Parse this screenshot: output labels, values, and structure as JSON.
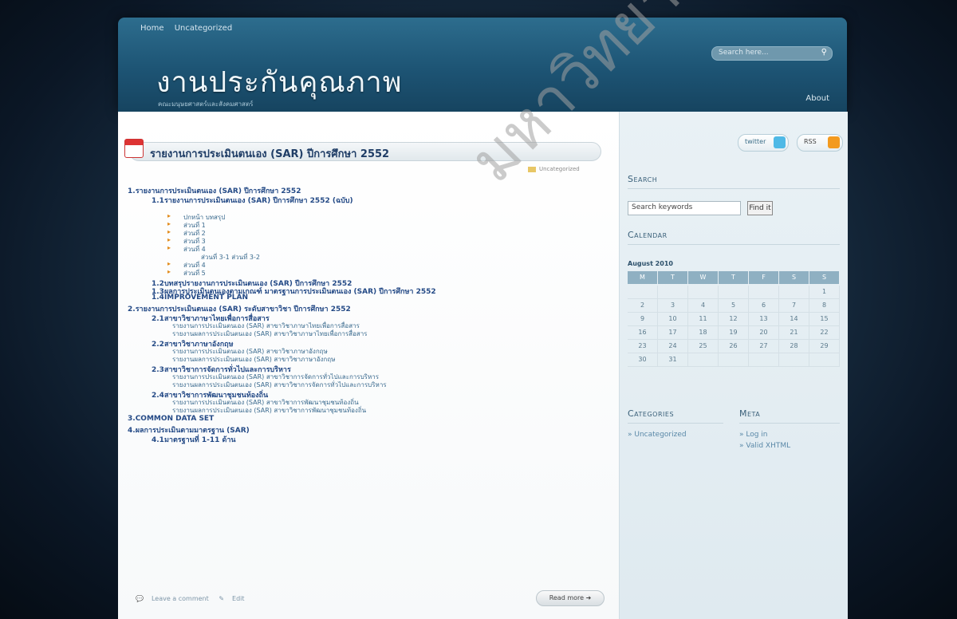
{
  "topnav": {
    "home": "Home",
    "uncategorized": "Uncategorized"
  },
  "site": {
    "title": "งานประกันคุณภาพ",
    "description": "คณะมนุษยศาสตร์และสังคมศาสตร์",
    "about": "About"
  },
  "search_top": {
    "placeholder": "Search here..."
  },
  "post": {
    "title": "รายงานการประเมินตนเอง (SAR) ปีการศึกษา 2552",
    "category": "Uncategorized",
    "toc": [
      {
        "num": "1.",
        "text": "รายงานการประเมินตนเอง (SAR) ปีการศึกษา 2552"
      },
      {
        "num": "1.1",
        "text": "รายงานการประเมินตนเอง (SAR) ปีการศึกษา 2552 (ฉบับ)"
      },
      {
        "num": "",
        "text": "ปกหน้า บทสรุป"
      },
      {
        "num": "",
        "text": "ส่วนที่ 1"
      },
      {
        "num": "",
        "text": "ส่วนที่ 2"
      },
      {
        "num": "",
        "text": "ส่วนที่ 3"
      },
      {
        "num": "",
        "text": "ส่วนที่ 4"
      },
      {
        "num": "",
        "text": "ส่วนที่ 3-1 ส่วนที่ 3-2"
      },
      {
        "num": "",
        "text": "ส่วนที่ 4"
      },
      {
        "num": "",
        "text": "ส่วนที่ 5"
      },
      {
        "num": "1.2",
        "text": "บทสรุปรายงานการประเมินตนเอง (SAR) ปีการศึกษา 2552"
      },
      {
        "num": "1.3",
        "text": "ผลการประเมินตนเองตามเกณฑ์ มาตรฐานการประเมินตนเอง (SAR) ปีการศึกษา 2552"
      },
      {
        "num": "1.4",
        "text": "IMPROVEMENT PLAN"
      },
      {
        "num": "2.",
        "text": "รายงานการประเมินตนเอง (SAR) ระดับสาขาวิชา ปีการศึกษา 2552"
      },
      {
        "num": "2.1",
        "text": "สาขาวิชาภาษาไทยเพื่อการสื่อสาร"
      },
      {
        "num": "",
        "text": "รายงานการประเมินตนเอง (SAR) สาขาวิชาภาษาไทยเพื่อการสื่อสาร"
      },
      {
        "num": "",
        "text": "รายงานผลการประเมินตนเอง (SAR) สาขาวิชาภาษาไทยเพื่อการสื่อสาร"
      },
      {
        "num": "2.2",
        "text": "สาขาวิชาภาษาอังกฤษ"
      },
      {
        "num": "",
        "text": "รายงานการประเมินตนเอง (SAR) สาขาวิชาภาษาอังกฤษ"
      },
      {
        "num": "",
        "text": "รายงานผลการประเมินตนเอง (SAR) สาขาวิชาภาษาอังกฤษ"
      },
      {
        "num": "2.3",
        "text": "สาขาวิชาการจัดการทั่วไปและการบริหาร"
      },
      {
        "num": "",
        "text": "รายงานการประเมินตนเอง (SAR) สาขาวิชาการจัดการทั่วไปและการบริหาร"
      },
      {
        "num": "",
        "text": "รายงานผลการประเมินตนเอง (SAR) สาขาวิชาการจัดการทั่วไปและการบริหาร"
      },
      {
        "num": "2.4",
        "text": "สาขาวิชาการพัฒนาชุมชนท้องถิ่น"
      },
      {
        "num": "",
        "text": "รายงานการประเมินตนเอง (SAR) สาขาวิชาการพัฒนาชุมชนท้องถิ่น"
      },
      {
        "num": "",
        "text": "รายงานผลการประเมินตนเอง (SAR) สาขาวิชาการพัฒนาชุมชนท้องถิ่น"
      },
      {
        "num": "3.",
        "text": "COMMON DATA SET"
      },
      {
        "num": "4.",
        "text": "ผลการประเมินตามมาตรฐาน (SAR)"
      },
      {
        "num": "4.1",
        "text": "มาตรฐานที่ 1-11 ด้าน"
      }
    ],
    "leave_comment": "Leave a comment",
    "edit": "Edit",
    "read_more": "Read more"
  },
  "sidebar": {
    "twitter": "twitter",
    "rss": "RSS",
    "search_heading": "Search",
    "search_placeholder": "Search keywords",
    "find_button": "Find it",
    "calendar_heading": "Calendar",
    "calendar_title": "August 2010",
    "weekdays": [
      "M",
      "T",
      "W",
      "T",
      "F",
      "S",
      "S"
    ],
    "weeks": [
      [
        "",
        "",
        "",
        "",
        "",
        "",
        "1"
      ],
      [
        "2",
        "3",
        "4",
        "5",
        "6",
        "7",
        "8"
      ],
      [
        "9",
        "10",
        "11",
        "12",
        "13",
        "14",
        "15"
      ],
      [
        "16",
        "17",
        "18",
        "19",
        "20",
        "21",
        "22"
      ],
      [
        "23",
        "24",
        "25",
        "26",
        "27",
        "28",
        "29"
      ],
      [
        "30",
        "31",
        "",
        "",
        "",
        "",
        ""
      ]
    ],
    "categories_heading": "Categories",
    "category_item": "Uncategorized",
    "meta_heading": "Meta",
    "meta_items": [
      "Log in",
      "Valid XHTML"
    ]
  },
  "watermark": "มหาวิทยาลัยราชภัฏวไลยอลงกรณ์"
}
